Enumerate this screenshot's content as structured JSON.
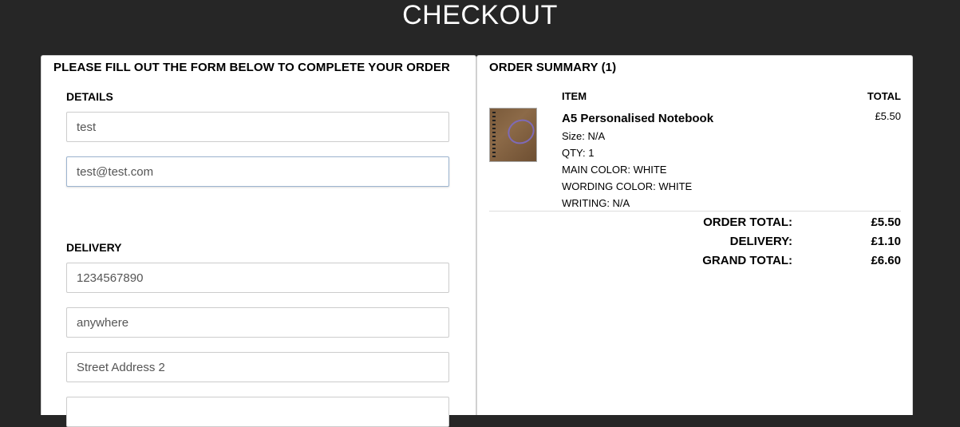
{
  "page": {
    "title": "CHECKOUT"
  },
  "form": {
    "heading": "PLEASE FILL OUT THE FORM BELOW TO COMPLETE YOUR ORDER",
    "details_label": "DETAILS",
    "name_value": "test",
    "email_value": "test@test.com",
    "delivery_label": "DELIVERY",
    "phone_value": "1234567890",
    "address1_value": "anywhere",
    "address2_placeholder": "Street Address 2"
  },
  "summary": {
    "heading": "ORDER SUMMARY (1)",
    "col_item": "ITEM",
    "col_total": "TOTAL",
    "item": {
      "name": "A5 Personalised Notebook",
      "price": "£5.50",
      "size": "Size: N/A",
      "qty": "QTY: 1",
      "main_color": "MAIN COLOR: WHITE",
      "wording_color": "WORDING COLOR: WHITE",
      "writing": "WRITING: N/A"
    },
    "totals": {
      "order_label": "ORDER TOTAL:",
      "order_value": "£5.50",
      "delivery_label": "DELIVERY:",
      "delivery_value": "£1.10",
      "grand_label": "GRAND TOTAL:",
      "grand_value": "£6.60"
    }
  },
  "icons": {
    "product_thumbnail": "notebook-image"
  }
}
